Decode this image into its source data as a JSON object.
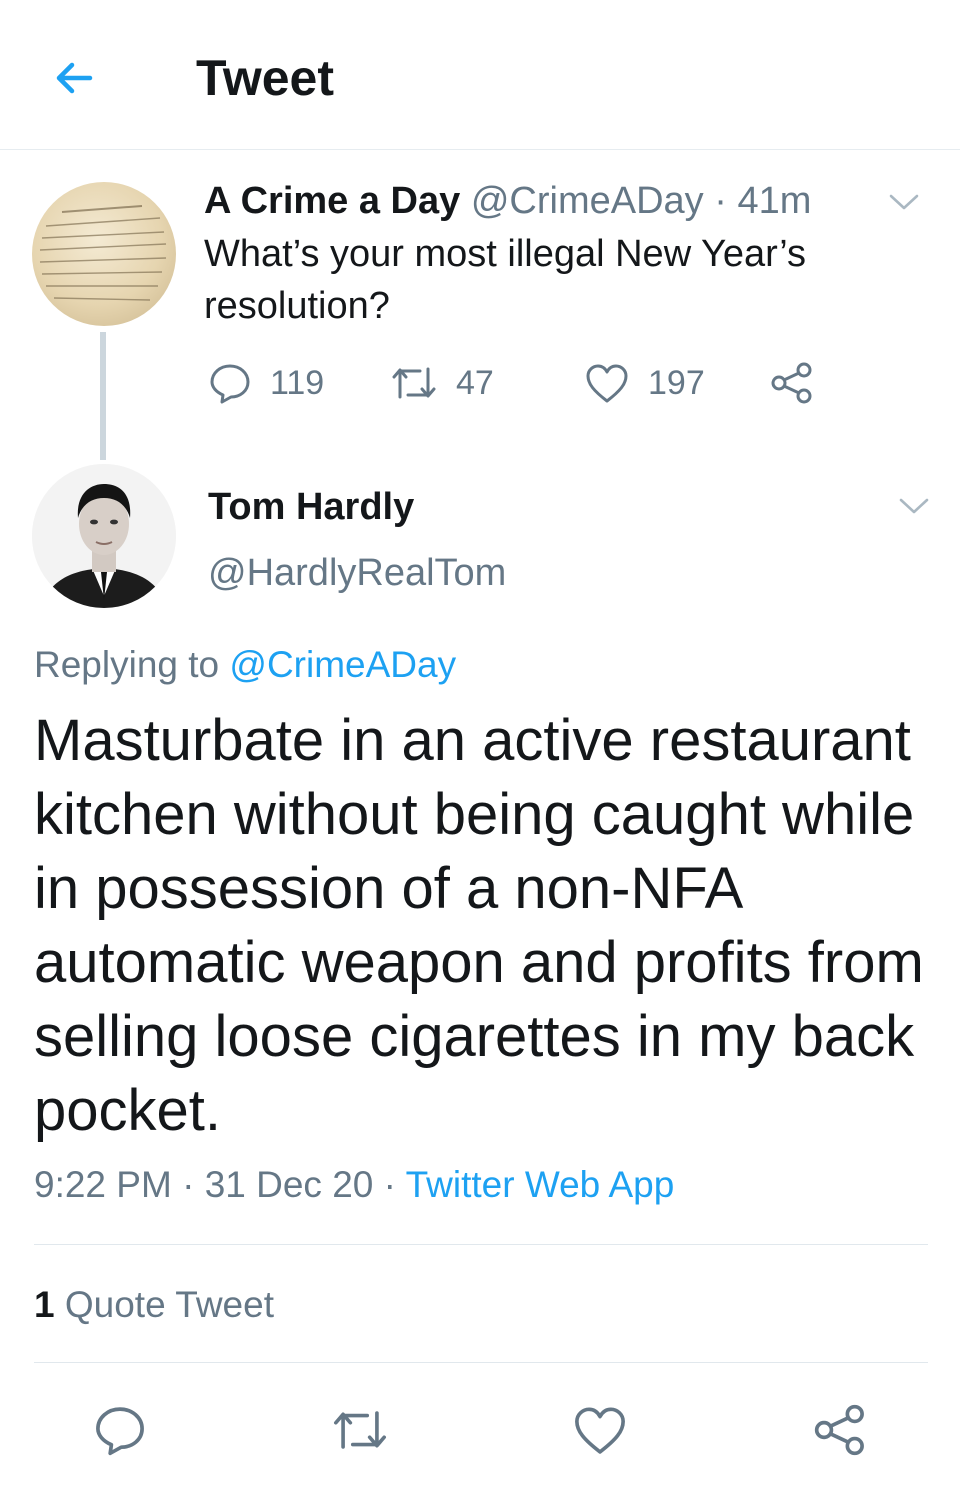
{
  "header": {
    "title": "Tweet"
  },
  "parent_tweet": {
    "author_name": "A Crime a Day",
    "author_handle": "@CrimeADay",
    "separator": "·",
    "time_ago": "41m",
    "text": "What’s your most illegal New Year’s resolution?",
    "reply_count": "119",
    "retweet_count": "47",
    "like_count": "197"
  },
  "main_tweet": {
    "author_name": "Tom Hardly",
    "author_handle": "@HardlyRealTom",
    "replying_prefix": "Replying to",
    "replying_handle": "@CrimeADay",
    "text": "Masturbate in an active restaurant kitchen without being caught while in possession of a non-NFA automatic weapon and profits from selling loose cigarettes in my back pocket.",
    "time": "9:22 PM",
    "date": "31 Dec 20",
    "separator": "·",
    "source": "Twitter Web App",
    "quote_count": "1",
    "quote_label": "Quote Tweet"
  },
  "colors": {
    "accent": "#1da1f2",
    "muted": "#657786",
    "text": "#14171a",
    "divider": "#e1e8ed"
  },
  "icons": {
    "back": "arrow-left-icon",
    "caret": "chevron-down-icon",
    "reply": "reply-icon",
    "retweet": "retweet-icon",
    "like": "heart-icon",
    "share": "share-icon"
  }
}
